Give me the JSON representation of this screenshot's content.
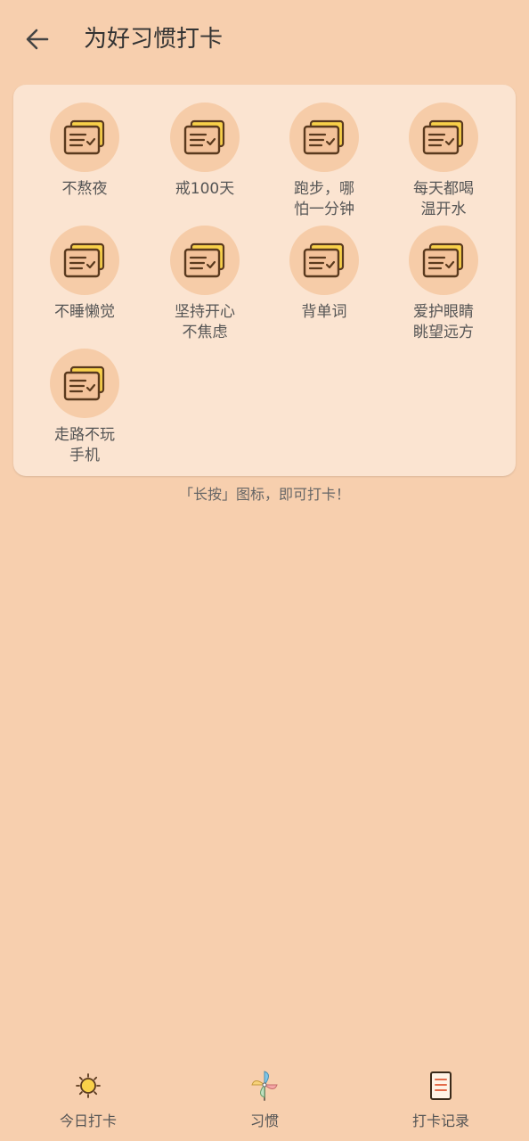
{
  "header": {
    "title": "为好习惯打卡",
    "back_icon": "arrow-left-icon"
  },
  "habits": [
    {
      "label": "不熬夜",
      "icon": "checklist-card-icon"
    },
    {
      "label": "戒100天",
      "icon": "checklist-card-icon"
    },
    {
      "label": "跑步，哪怕一分钟",
      "icon": "checklist-card-icon"
    },
    {
      "label": "每天都喝温开水",
      "icon": "checklist-card-icon"
    },
    {
      "label": "不睡懒觉",
      "icon": "checklist-card-icon"
    },
    {
      "label": "坚持开心不焦虑",
      "icon": "checklist-card-icon"
    },
    {
      "label": "背单词",
      "icon": "checklist-card-icon"
    },
    {
      "label": "爱护眼睛眺望远方",
      "icon": "checklist-card-icon"
    },
    {
      "label": "走路不玩手机",
      "icon": "checklist-card-icon"
    }
  ],
  "hint": "「长按」图标，即可打卡！",
  "bottom_nav": {
    "items": [
      {
        "label": "今日打卡",
        "icon": "sun-icon"
      },
      {
        "label": "习惯",
        "icon": "pinwheel-icon"
      },
      {
        "label": "打卡记录",
        "icon": "record-book-icon"
      }
    ]
  },
  "colors": {
    "background": "#f7cfae",
    "card": "#fbe4d1",
    "icon_circle": "#f6cca8",
    "icon_yellow": "#f9d14a",
    "icon_outline": "#5a3a1e"
  }
}
